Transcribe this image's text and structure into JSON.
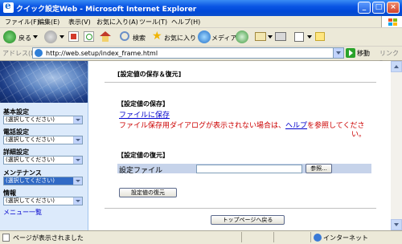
{
  "window": {
    "title": "クイック設定Web - Microsoft Internet Explorer",
    "controls": [
      "_",
      "□",
      "×"
    ]
  },
  "menu": [
    "ファイル(F)",
    "編集(E)",
    "表示(V)",
    "お気に入り(A)",
    "ツール(T)",
    "ヘルプ(H)"
  ],
  "toolbar": {
    "back_label": "戻る",
    "search_label": "検索",
    "favorites_label": "お気に入り",
    "media_label": "メディア"
  },
  "address": {
    "label": "アドレス(D)",
    "url": "http://web.setup/index_frame.html",
    "go_label": "移動",
    "links_label": "リンク »"
  },
  "sidebar": {
    "sections": [
      {
        "title": "基本設定",
        "value": "(選択してください)"
      },
      {
        "title": "電話設定",
        "value": "(選択してください)"
      },
      {
        "title": "詳細設定",
        "value": "(選択してください)"
      },
      {
        "title": "メンテナンス",
        "value": "(選択してください)"
      },
      {
        "title": "情報",
        "value": "(選択してください)"
      }
    ],
    "menu_link": "メニュー一覧"
  },
  "main": {
    "heading": "[設定値の保存＆復元]",
    "save": {
      "title": "【設定値の保存】",
      "link": "ファイルに保存",
      "error_before": "ファイル保存用ダイアログが表示されない場合は、",
      "error_link": "ヘルプ",
      "error_after": "を参照してくださ",
      "error_line2": "い。"
    },
    "restore": {
      "title": "【設定値の復元】",
      "file_label": "設定ファイル",
      "browse_button": "参照...",
      "restore_button": "設定値の復元"
    },
    "top_button": "トップページへ戻る"
  },
  "status": {
    "message": "ページが表示されました",
    "zone": "インターネット"
  },
  "colors": {
    "titlebar": "#0A55E4",
    "sidebar_bg": "#DCEAFB",
    "error_text": "#CC0000",
    "link": "#0000CC",
    "selected": "#316AC5"
  }
}
